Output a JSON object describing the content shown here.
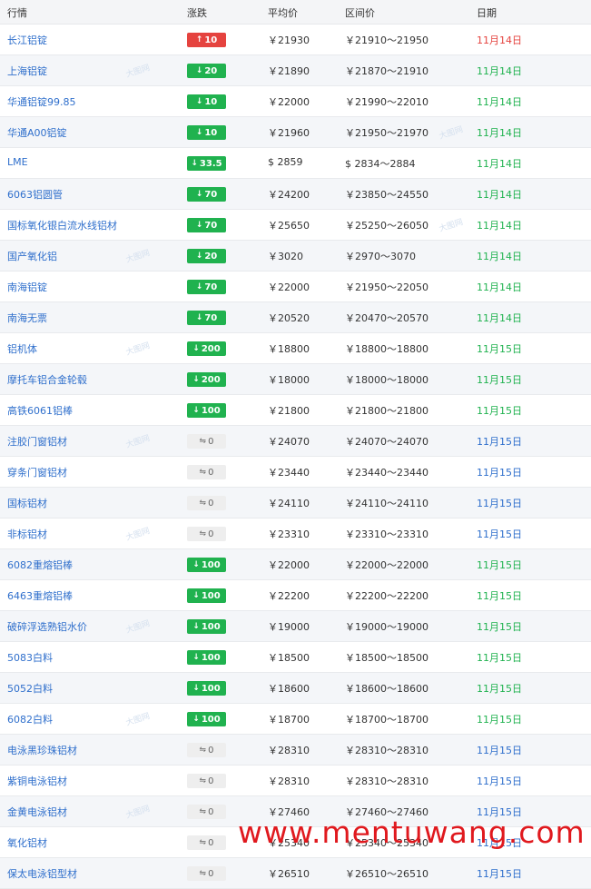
{
  "headers": {
    "market": "行情",
    "change": "涨跌",
    "avg": "平均价",
    "range": "区间价",
    "date": "日期"
  },
  "watermark_text": "大图网",
  "bottom_watermark": "www.mentuwang.com",
  "colors": {
    "up": "#e5433f",
    "down": "#20b24f",
    "link": "#2f6fcc"
  },
  "rows": [
    {
      "name": "长江铝锭",
      "dir": "up",
      "change": "10",
      "avg": "￥21930",
      "range": "￥21910～21950",
      "date": "11月14日",
      "date_color": "red"
    },
    {
      "name": "上海铝锭",
      "dir": "down",
      "change": "20",
      "avg": "￥21890",
      "range": "￥21870～21910",
      "date": "11月14日",
      "date_color": "green"
    },
    {
      "name": "华通铝锭99.85",
      "dir": "down",
      "change": "10",
      "avg": "￥22000",
      "range": "￥21990～22010",
      "date": "11月14日",
      "date_color": "green"
    },
    {
      "name": "华通A00铝锭",
      "dir": "down",
      "change": "10",
      "avg": "￥21960",
      "range": "￥21950～21970",
      "date": "11月14日",
      "date_color": "green"
    },
    {
      "name": "LME",
      "dir": "down",
      "change": "33.5",
      "avg": "$ 2859",
      "range": "$ 2834～2884",
      "date": "11月14日",
      "date_color": "green"
    },
    {
      "name": "6063铝圆管",
      "dir": "down",
      "change": "70",
      "avg": "￥24200",
      "range": "￥23850～24550",
      "date": "11月14日",
      "date_color": "green"
    },
    {
      "name": "国标氧化银白流水线铝材",
      "dir": "down",
      "change": "70",
      "avg": "￥25650",
      "range": "￥25250～26050",
      "date": "11月14日",
      "date_color": "green"
    },
    {
      "name": "国产氧化铝",
      "dir": "down",
      "change": "20",
      "avg": "￥3020",
      "range": "￥2970～3070",
      "date": "11月14日",
      "date_color": "green"
    },
    {
      "name": "南海铝锭",
      "dir": "down",
      "change": "70",
      "avg": "￥22000",
      "range": "￥21950～22050",
      "date": "11月14日",
      "date_color": "green"
    },
    {
      "name": "南海无票",
      "dir": "down",
      "change": "70",
      "avg": "￥20520",
      "range": "￥20470～20570",
      "date": "11月14日",
      "date_color": "green"
    },
    {
      "name": "铝机体",
      "dir": "down",
      "change": "200",
      "avg": "￥18800",
      "range": "￥18800～18800",
      "date": "11月15日",
      "date_color": "green"
    },
    {
      "name": "摩托车铝合金轮毂",
      "dir": "down",
      "change": "200",
      "avg": "￥18000",
      "range": "￥18000～18000",
      "date": "11月15日",
      "date_color": "green"
    },
    {
      "name": "高铁6061铝棒",
      "dir": "down",
      "change": "100",
      "avg": "￥21800",
      "range": "￥21800～21800",
      "date": "11月15日",
      "date_color": "green"
    },
    {
      "name": "注胶门窗铝材",
      "dir": "flat",
      "change": "0",
      "avg": "￥24070",
      "range": "￥24070～24070",
      "date": "11月15日",
      "date_color": "blue"
    },
    {
      "name": "穿条门窗铝材",
      "dir": "flat",
      "change": "0",
      "avg": "￥23440",
      "range": "￥23440～23440",
      "date": "11月15日",
      "date_color": "blue"
    },
    {
      "name": "国标铝材",
      "dir": "flat",
      "change": "0",
      "avg": "￥24110",
      "range": "￥24110～24110",
      "date": "11月15日",
      "date_color": "blue"
    },
    {
      "name": "非标铝材",
      "dir": "flat",
      "change": "0",
      "avg": "￥23310",
      "range": "￥23310～23310",
      "date": "11月15日",
      "date_color": "blue"
    },
    {
      "name": "6082重熔铝棒",
      "dir": "down",
      "change": "100",
      "avg": "￥22000",
      "range": "￥22000～22000",
      "date": "11月15日",
      "date_color": "green"
    },
    {
      "name": "6463重熔铝棒",
      "dir": "down",
      "change": "100",
      "avg": "￥22200",
      "range": "￥22200～22200",
      "date": "11月15日",
      "date_color": "green"
    },
    {
      "name": "破碎浮选熟铝水价",
      "dir": "down",
      "change": "100",
      "avg": "￥19000",
      "range": "￥19000～19000",
      "date": "11月15日",
      "date_color": "green"
    },
    {
      "name": "5083白料",
      "dir": "down",
      "change": "100",
      "avg": "￥18500",
      "range": "￥18500～18500",
      "date": "11月15日",
      "date_color": "green"
    },
    {
      "name": "5052白料",
      "dir": "down",
      "change": "100",
      "avg": "￥18600",
      "range": "￥18600～18600",
      "date": "11月15日",
      "date_color": "green"
    },
    {
      "name": "6082白料",
      "dir": "down",
      "change": "100",
      "avg": "￥18700",
      "range": "￥18700～18700",
      "date": "11月15日",
      "date_color": "green"
    },
    {
      "name": "电泳黑珍珠铝材",
      "dir": "flat",
      "change": "0",
      "avg": "￥28310",
      "range": "￥28310～28310",
      "date": "11月15日",
      "date_color": "blue"
    },
    {
      "name": "紫铜电泳铝材",
      "dir": "flat",
      "change": "0",
      "avg": "￥28310",
      "range": "￥28310～28310",
      "date": "11月15日",
      "date_color": "blue"
    },
    {
      "name": "金黄电泳铝材",
      "dir": "flat",
      "change": "0",
      "avg": "￥27460",
      "range": "￥27460～27460",
      "date": "11月15日",
      "date_color": "blue"
    },
    {
      "name": "氧化铝材",
      "dir": "flat",
      "change": "0",
      "avg": "￥25340",
      "range": "￥25340～25340",
      "date": "11月15日",
      "date_color": "blue"
    },
    {
      "name": "保太电泳铝型材",
      "dir": "flat",
      "change": "0",
      "avg": "￥26510",
      "range": "￥26510～26510",
      "date": "11月15日",
      "date_color": "blue"
    }
  ]
}
